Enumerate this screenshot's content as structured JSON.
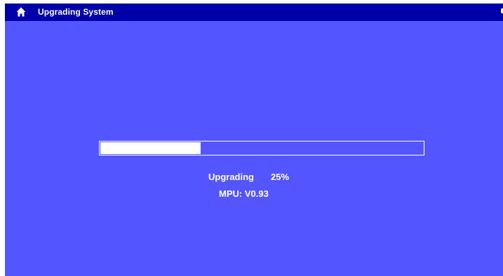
{
  "header": {
    "title": "Upgrading System",
    "home_icon": "home-icon"
  },
  "progress": {
    "label": "Upgrading",
    "percent_text": "25%",
    "fraction": 0.31
  },
  "firmware": {
    "version_text": "MPU: V0.93"
  },
  "colors": {
    "background": "#5555ff",
    "titlebar": "#0000a8",
    "text": "#ffffff",
    "progress_fill": "#ffffff"
  }
}
